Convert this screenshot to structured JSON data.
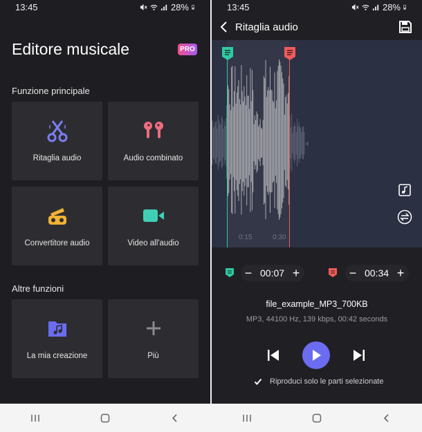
{
  "status": {
    "time": "13:45",
    "battery": "28%"
  },
  "editor": {
    "title": "Editore musicale",
    "pro_badge": "PRO",
    "main_section": "Funzione principale",
    "main_tiles": [
      {
        "label": "Ritaglia audio",
        "icon": "scissors-icon"
      },
      {
        "label": "Audio combinato",
        "icon": "earbuds-icon"
      },
      {
        "label": "Convertitore audio",
        "icon": "converter-icon"
      },
      {
        "label": "Video all'audio",
        "icon": "video-camera-icon"
      }
    ],
    "other_section": "Altre funzioni",
    "other_tiles": [
      {
        "label": "La mia creazione",
        "icon": "music-folder-icon"
      },
      {
        "label": "Più",
        "icon": "plus-icon"
      }
    ]
  },
  "trim": {
    "title": "Ritaglia audio",
    "ticks": [
      "0:15",
      "0:30"
    ],
    "start_time": "00:07",
    "end_time": "00:34",
    "minus": "−",
    "plus": "+",
    "file_name": "file_example_MP3_700KB",
    "file_meta": "MP3, 44100 Hz, 139 kbps, 00:42 seconds",
    "checkbox_label": "Riproduci solo le parti selezionate",
    "checkbox_checked": true
  },
  "colors": {
    "accent": "#6b6cf0",
    "start_marker": "#2fc9a3",
    "end_marker": "#ef5b5b",
    "background": "#1e1e22"
  }
}
